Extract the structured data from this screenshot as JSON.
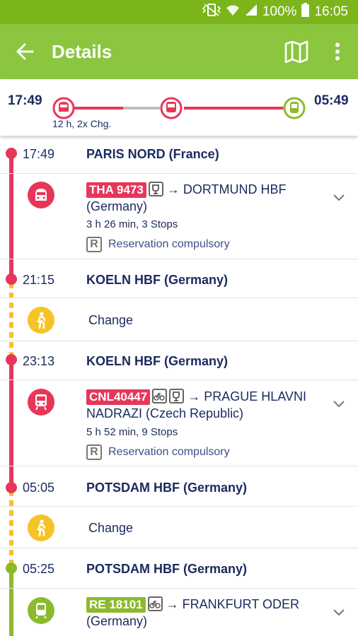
{
  "status": {
    "battery": "100%",
    "time": "16:05"
  },
  "appbar": {
    "title": "Details"
  },
  "summary": {
    "dep": "17:49",
    "arr": "05:49",
    "duration": "12 h, 2x Chg."
  },
  "colors": {
    "green": "#8cc63f",
    "red": "#e8365a",
    "yellow": "#f5c325",
    "lime": "#8cba2c"
  },
  "stops": [
    {
      "time": "17:49",
      "name": "PARIS NORD (France)"
    },
    {
      "time": "21:15",
      "name": "KOELN HBF (Germany)"
    },
    {
      "time": "23:13",
      "name": "KOELN HBF (Germany)"
    },
    {
      "time": "05:05",
      "name": "POTSDAM HBF (Germany)"
    },
    {
      "time": "05:25",
      "name": "POTSDAM HBF (Germany)"
    }
  ],
  "legs": [
    {
      "train": "THA 9473",
      "dest": "→ DORTMUND HBF",
      "dest2": "(Germany)",
      "info": "3 h 26 min, 3 Stops",
      "reservation": "Reservation compulsory"
    },
    {
      "train": "CNL40447",
      "dest": "→ PRAGUE HLAVNI",
      "dest2": "NADRAZI (Czech Republic)",
      "info": "5 h 52 min, 9 Stops",
      "reservation": "Reservation compulsory"
    },
    {
      "train": "RE 18101",
      "dest": "→ FRANKFURT ODER",
      "dest2": "(Germany)"
    }
  ],
  "changes": [
    {
      "label": "Change"
    },
    {
      "label": "Change"
    }
  ]
}
